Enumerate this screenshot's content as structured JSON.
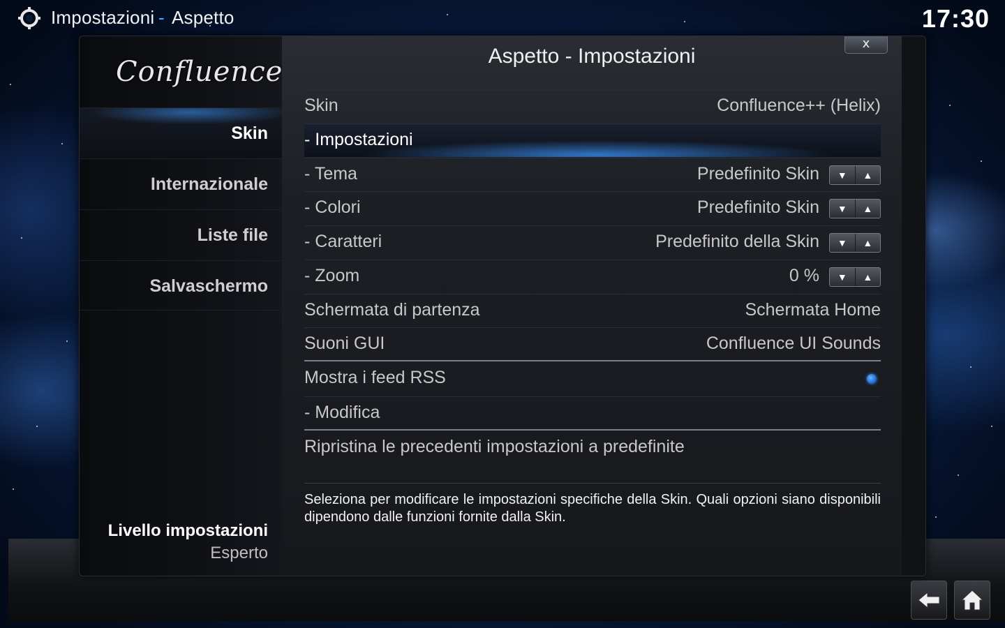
{
  "topbar": {
    "crumb_primary": "Impostazioni",
    "crumb_separator": "-",
    "crumb_secondary": "Aspetto",
    "clock": "17:30"
  },
  "sidebar": {
    "logo": "Confluence",
    "items": [
      {
        "label": "Skin",
        "active": true
      },
      {
        "label": "Internazionale",
        "active": false
      },
      {
        "label": "Liste file",
        "active": false
      },
      {
        "label": "Salvaschermo",
        "active": false
      }
    ],
    "level_label": "Livello impostazioni",
    "level_value": "Esperto"
  },
  "dialog": {
    "title": "Aspetto - Impostazioni",
    "close_label": "x"
  },
  "settings": {
    "rows": [
      {
        "label": "Skin",
        "value": "Confluence++ (Helix)"
      },
      {
        "label": "- Impostazioni",
        "value": ""
      },
      {
        "label": "- Tema",
        "value": "Predefinito Skin"
      },
      {
        "label": "- Colori",
        "value": "Predefinito Skin"
      },
      {
        "label": "- Caratteri",
        "value": "Predefinito della Skin"
      },
      {
        "label": "- Zoom",
        "value": "0 %"
      },
      {
        "label": "Schermata di partenza",
        "value": "Schermata Home"
      },
      {
        "label": "Suoni GUI",
        "value": "Confluence UI Sounds"
      },
      {
        "label": "Mostra i feed RSS",
        "value": ""
      },
      {
        "label": "- Modifica",
        "value": ""
      },
      {
        "label": "Ripristina le precedenti impostazioni a predefinite",
        "value": ""
      }
    ],
    "focused_row": "- Impostazioni",
    "rss_toggle_on": true
  },
  "spinner": {
    "down": "▼",
    "up": "▲"
  },
  "description": "Seleziona per modificare le impostazioni specifiche della Skin. Quali opzioni siano disponibili dipendono dalle funzioni fornite dalla Skin.",
  "nav": {
    "back_icon": "back-arrow-icon",
    "home_icon": "home-icon"
  },
  "colors": {
    "accent": "#3c96ff",
    "panel": "#16181c"
  }
}
